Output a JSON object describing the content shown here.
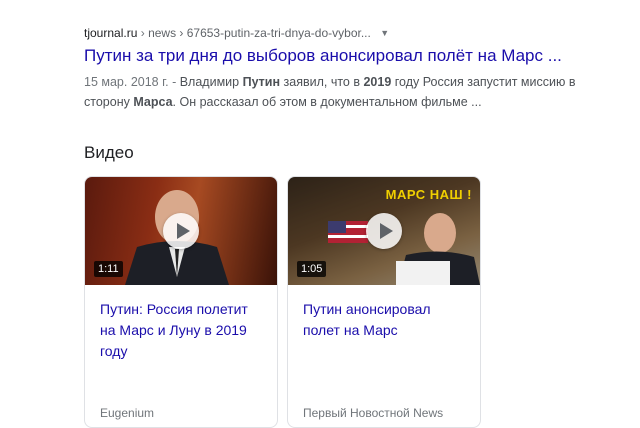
{
  "result": {
    "domain": "tjournal.ru",
    "breadcrumb_sep": "›",
    "path": "news › 67653-putin-za-tri-dnya-do-vybor...",
    "title": "Путин за три дня до выборов анонсировал полёт на Марс ...",
    "snippet": {
      "date": "15 мар. 2018 г. -",
      "t1": " Владимир ",
      "b1": "Путин",
      "t2": " заявил, что в ",
      "b2": "2019",
      "t3": " году Россия запустит миссию в сторону ",
      "b3": "Марса",
      "t4": ". Он рассказал об этом в документальном фильме ..."
    }
  },
  "videos": {
    "heading": "Видео",
    "items": [
      {
        "title": "Путин: Россия полетит на Марс и Луну в 2019 году",
        "duration": "1:11",
        "source": "Eugenium"
      },
      {
        "title": "Путин анонсировал полет на Марс",
        "duration": "1:05",
        "source": "Первый Новостной News",
        "banner": "МАРС НАШ !"
      }
    ]
  },
  "icons": {
    "more": "chevron-down-icon",
    "play": "play-icon"
  },
  "colors": {
    "link": "#1a0dab",
    "text": "#4d5156",
    "meta": "#70757a",
    "border": "#dfe1e5"
  }
}
